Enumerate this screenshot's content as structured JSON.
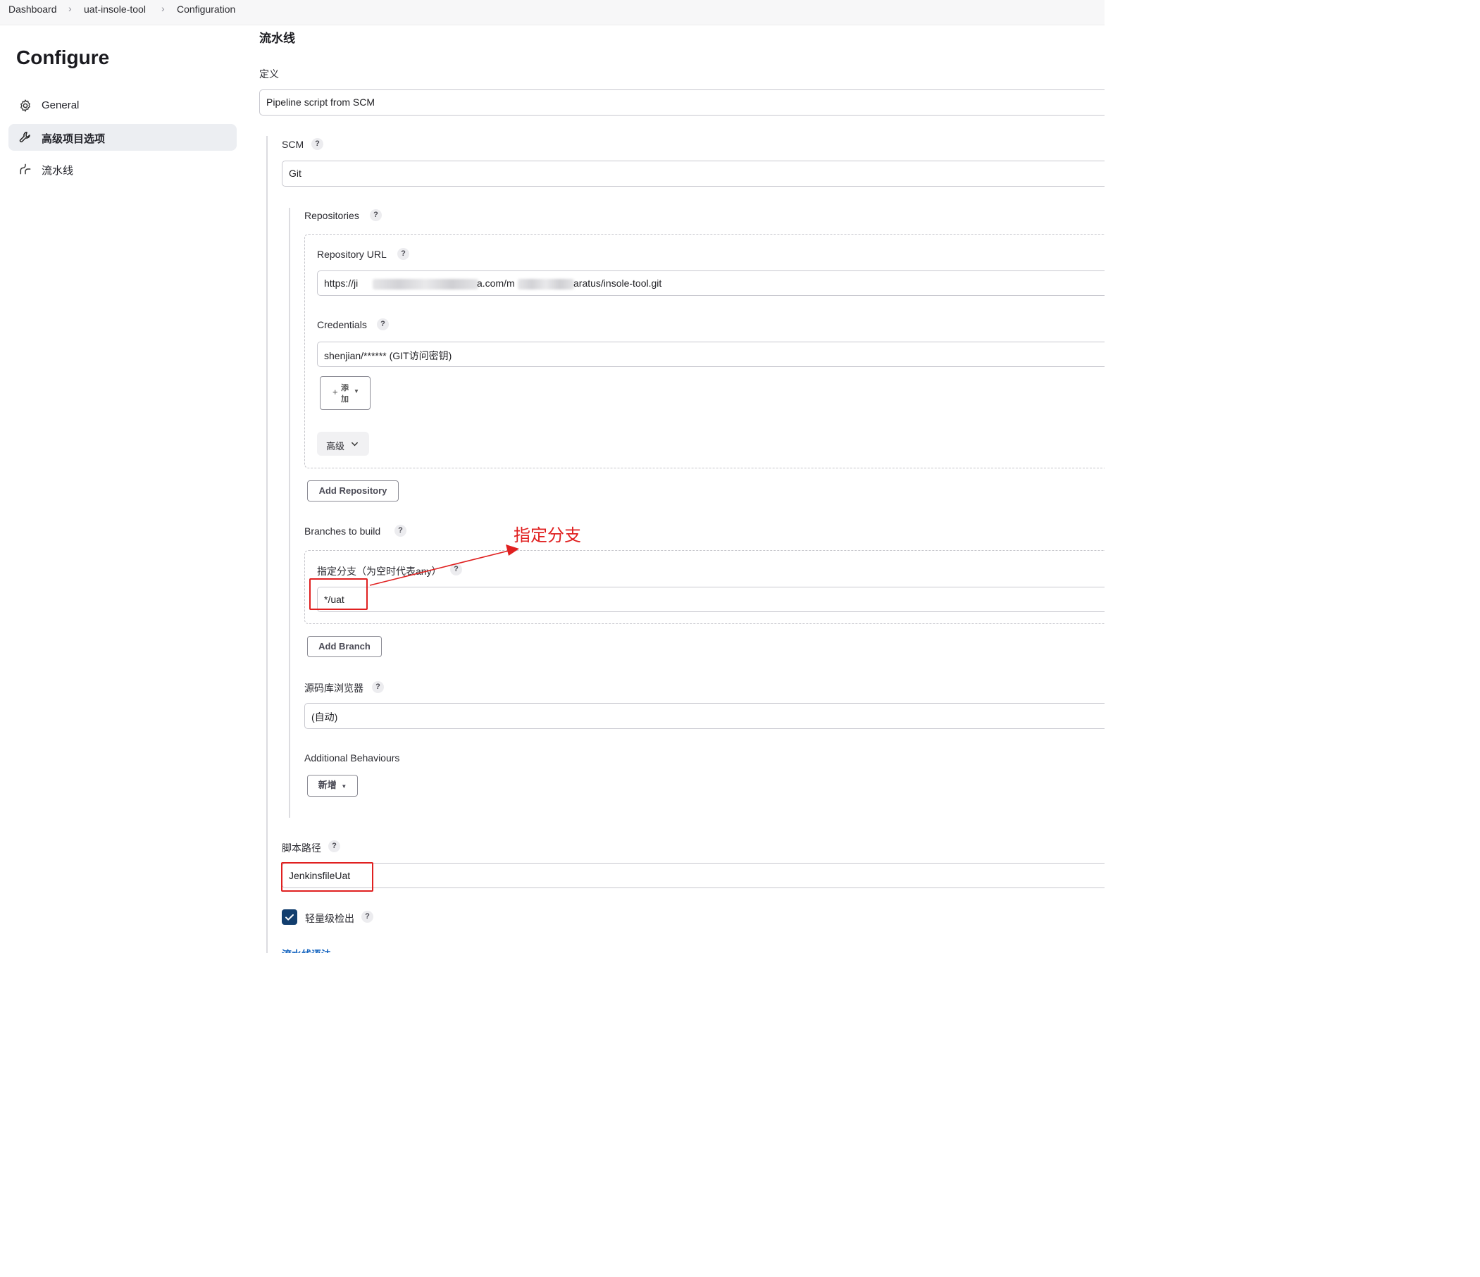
{
  "breadcrumb": [
    "Dashboard",
    "uat-insole-tool",
    "Configuration"
  ],
  "sidebar": {
    "title": "Configure",
    "items": [
      {
        "label": "General",
        "icon": "gear-icon",
        "active": false
      },
      {
        "label": "高级项目选项",
        "icon": "wrench-icon",
        "active": true
      },
      {
        "label": "流水线",
        "icon": "pipeline-icon",
        "active": false
      }
    ]
  },
  "main": {
    "section_title": "流水线",
    "definition_label": "定义",
    "definition_value": "Pipeline script from SCM",
    "scm_label": "SCM",
    "scm_value": "Git",
    "repositories_label": "Repositories",
    "repo_url_label": "Repository URL",
    "repo_url_prefix": "https://ji",
    "repo_url_mid": "a.com/m",
    "repo_url_suffix": "aratus/insole-tool.git",
    "credentials_label": "Credentials",
    "credentials_value": "shenjian/****** (GIT访问密钥)",
    "add_button_label_top": "添",
    "add_button_label_bottom": "加",
    "advanced_label": "高级",
    "add_repository_label": "Add Repository",
    "branches_label": "Branches to build",
    "branch_specifier_label": "指定分支（为空时代表any）",
    "branch_value": "*/uat",
    "add_branch_label": "Add Branch",
    "repo_browser_label": "源码库浏览器",
    "repo_browser_value": "(自动)",
    "additional_behaviours_label": "Additional Behaviours",
    "new_button_label": "新增",
    "script_path_label": "脚本路径",
    "script_path_value": "JenkinsfileUat",
    "lightweight_checkout_label": "轻量级检出",
    "lightweight_checkout_checked": true,
    "pipeline_syntax_link": "流水线语法"
  },
  "annotation": {
    "text": "指定分支",
    "color": "#e02020"
  },
  "help_symbol": "?"
}
